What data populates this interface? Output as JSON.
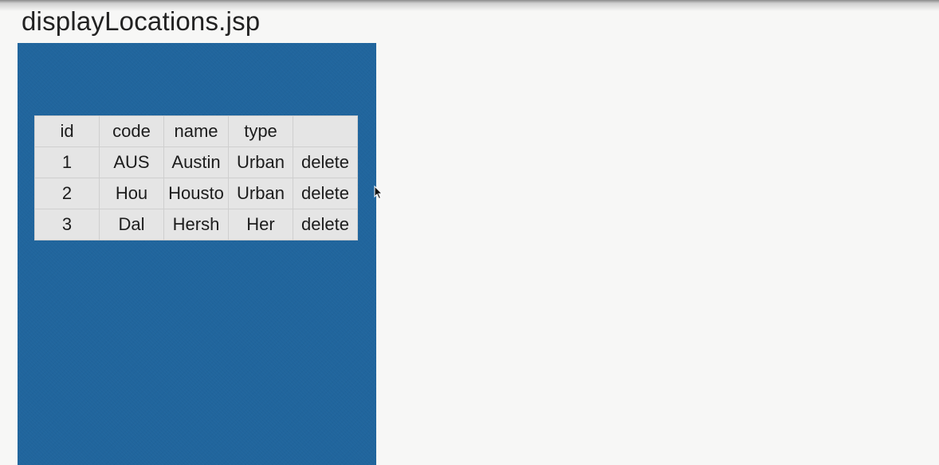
{
  "page": {
    "title": "displayLocations.jsp"
  },
  "table": {
    "headers": [
      "id",
      "code",
      "name",
      "type",
      ""
    ],
    "rows": [
      {
        "id": "1",
        "code": "AUS",
        "name": "Austin",
        "type": "Urban",
        "action": "delete"
      },
      {
        "id": "2",
        "code": "Hou",
        "name": "Housto",
        "type": "Urban",
        "action": "delete"
      },
      {
        "id": "3",
        "code": "Dal",
        "name": "Hersh",
        "type": "Her",
        "action": "delete"
      }
    ]
  },
  "colors": {
    "panel": "#20659d",
    "table_bg": "#e5e5e5",
    "background": "#f7f7f6"
  },
  "icons": {
    "cursor": "mouse-pointer-icon"
  }
}
